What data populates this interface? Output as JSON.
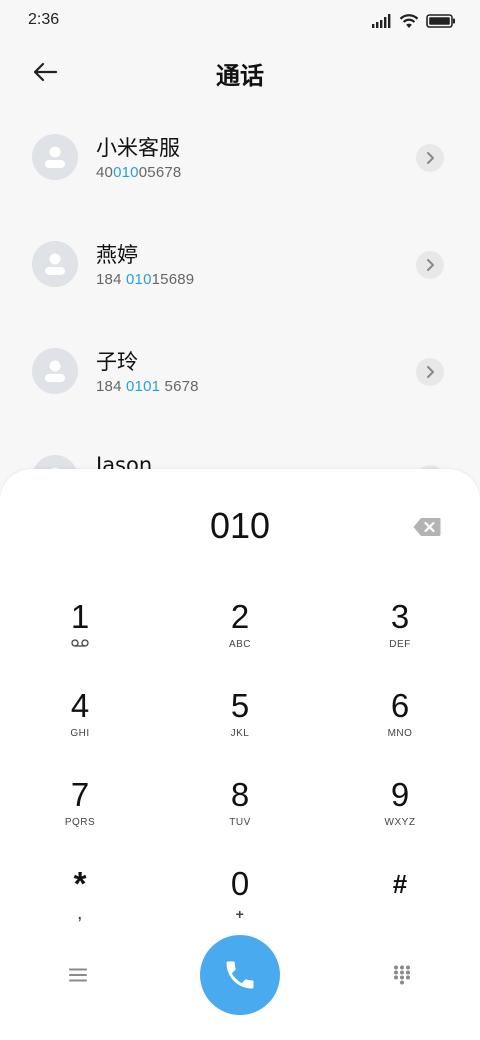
{
  "status_bar": {
    "time": "2:36"
  },
  "header": {
    "title": "通话"
  },
  "contacts": [
    {
      "name": "小米客服",
      "number_parts": [
        "40",
        "010",
        "05678"
      ]
    },
    {
      "name": "燕婷",
      "number_parts": [
        "184 ",
        "010",
        "15689"
      ]
    },
    {
      "name": "子玲",
      "number_parts": [
        "184 ",
        "0101",
        " 5678"
      ]
    },
    {
      "name": "Jason"
    }
  ],
  "dialpad": {
    "entered_number": "010",
    "keys": [
      {
        "digit": "1",
        "letters": ""
      },
      {
        "digit": "2",
        "letters": "ABC"
      },
      {
        "digit": "3",
        "letters": "DEF"
      },
      {
        "digit": "4",
        "letters": "GHI"
      },
      {
        "digit": "5",
        "letters": "JKL"
      },
      {
        "digit": "6",
        "letters": "MNO"
      },
      {
        "digit": "7",
        "letters": "PQRS"
      },
      {
        "digit": "8",
        "letters": "TUV"
      },
      {
        "digit": "9",
        "letters": "WXYZ"
      },
      {
        "digit": "*",
        "letters": ","
      },
      {
        "digit": "0",
        "letters": "+"
      },
      {
        "digit": "#",
        "letters": ""
      }
    ]
  },
  "icons": {
    "back": "arrow-left-icon",
    "backspace": "backspace-icon",
    "voicemail": "voicemail-icon",
    "menu": "menu-icon",
    "call": "phone-icon",
    "keypad": "keypad-icon"
  },
  "colors": {
    "accent": "#2a9fe0",
    "call_button": "#4aaaf0"
  }
}
